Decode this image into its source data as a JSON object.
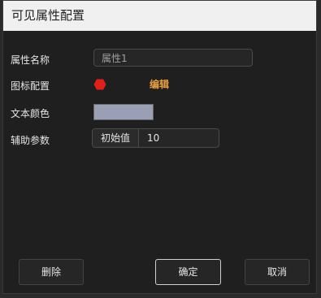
{
  "dialog": {
    "title": "可见属性配置"
  },
  "form": {
    "name_label": "属性名称",
    "name_value": "属性1",
    "icon_label": "图标配置",
    "icon_name": "red-hexagon-icon",
    "icon_color": "#e0201a",
    "edit_label": "编辑",
    "text_color_label": "文本颜色",
    "text_color_value": "#9a9fb5",
    "aux_label": "辅助参数",
    "aux_addon": "初始值",
    "aux_value": "10"
  },
  "footer": {
    "delete_label": "删除",
    "ok_label": "确定",
    "cancel_label": "取消"
  }
}
